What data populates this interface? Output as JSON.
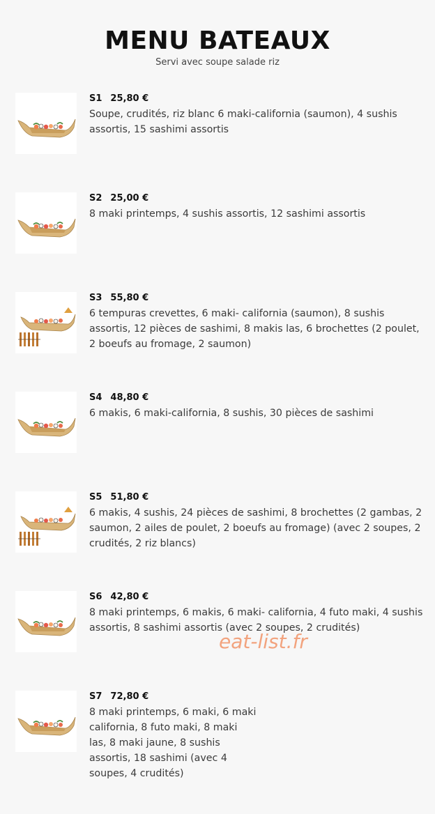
{
  "header": {
    "title": "MENU BATEAUX",
    "subtitle": "Servi avec soupe salade riz"
  },
  "items": [
    {
      "code": "S1",
      "price": "25,80 €",
      "description": "Soupe, crudités, riz blanc 6 maki-california (saumon), 4 sushis assortis, 15 sashimi assortis",
      "image": "sushi-boat-image"
    },
    {
      "code": "S2",
      "price": "25,00 €",
      "description": "8 maki printemps, 4 sushis assortis, 12 sashimi assortis",
      "image": "sushi-boat-image"
    },
    {
      "code": "S3",
      "price": "55,80 €",
      "description": "6 tempuras crevettes, 6 maki- california (saumon), 8 sushis assortis, 12 pièces de sashimi, 8 makis las, 6 brochettes (2 poulet, 2 boeufs au fromage, 2 saumon)",
      "image": "sushi-boat-skewers-image"
    },
    {
      "code": "S4",
      "price": "48,80 €",
      "description": "6 makis, 6 maki-california, 8 sushis, 30 pièces de sashimi",
      "image": "sushi-boat-image"
    },
    {
      "code": "S5",
      "price": "51,80 €",
      "description": "6 makis, 4 sushis, 24 pièces de sashimi, 8 brochettes (2 gambas, 2 saumon, 2 ailes de poulet, 2 boeufs au fromage) (avec 2 soupes, 2 crudités, 2 riz blancs)",
      "image": "sushi-boat-skewers-image"
    },
    {
      "code": "S6",
      "price": "42,80 €",
      "description": "8 maki printemps, 6 makis, 6 maki- california, 4 futo maki, 4 sushis assortis, 8 sashimi assortis (avec 2 soupes, 2 crudités)",
      "image": "sushi-boat-image"
    },
    {
      "code": "S7",
      "price": "72,80 €",
      "description": "8 maki printemps, 6 maki, 6 maki california, 8 futo maki, 8 maki las, 8 maki jaune, 8 sushis assortis, 18 sashimi (avec 4 soupes, 4 crudités)",
      "image": "sushi-boat-image"
    }
  ],
  "watermark": "eat-list.fr"
}
